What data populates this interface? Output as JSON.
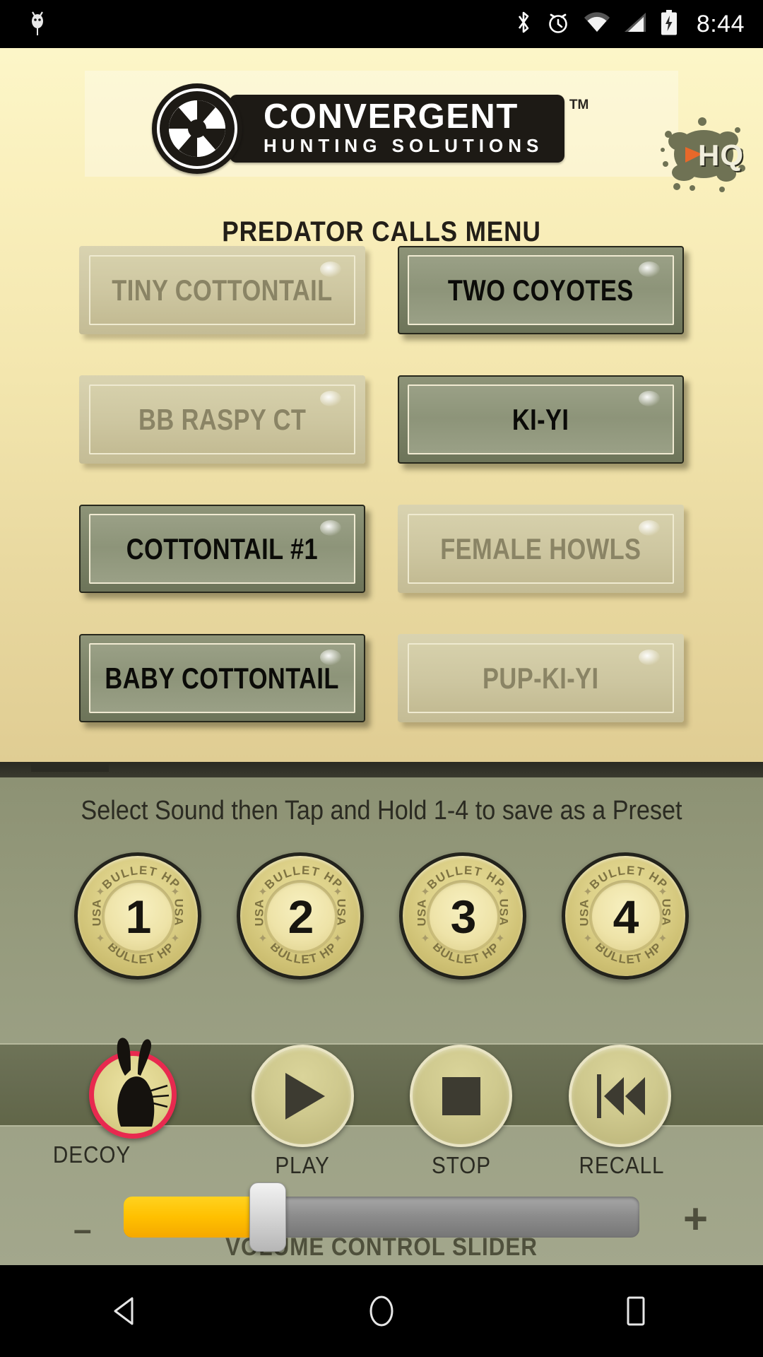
{
  "statusbar": {
    "time": "8:44",
    "icons": [
      "android-debug-icon",
      "bluetooth-icon",
      "alarm-icon",
      "wifi-icon",
      "cellular-signal-icon",
      "battery-charging-icon"
    ]
  },
  "header": {
    "logo_main": "CONVERGENT",
    "logo_sub": "HUNTING SOLUTIONS",
    "trademark": "TM",
    "menu_title": "PREDATOR CALLS MENU",
    "hq_label": "HQ"
  },
  "sounds": {
    "rows": [
      [
        {
          "label": "TINY COTTONTAIL",
          "active": false
        },
        {
          "label": "TWO COYOTES",
          "active": true
        }
      ],
      [
        {
          "label": "BB RASPY CT",
          "active": false
        },
        {
          "label": "KI-YI",
          "active": true
        }
      ],
      [
        {
          "label": "COTTONTAIL #1",
          "active": true
        },
        {
          "label": "FEMALE HOWLS",
          "active": false
        }
      ],
      [
        {
          "label": "BABY COTTONTAIL",
          "active": true
        },
        {
          "label": "PUP-KI-YI",
          "active": false
        }
      ]
    ]
  },
  "controls": {
    "hint": "Select Sound then Tap and Hold 1-4 to save as a Preset",
    "presets": [
      {
        "number": "1",
        "top_text": "BULLET HP",
        "bottom_text": "BULLET HP",
        "left_text": "USA",
        "right_text": "USA"
      },
      {
        "number": "2",
        "top_text": "BULLET HP",
        "bottom_text": "BULLET HP",
        "left_text": "USA",
        "right_text": "USA"
      },
      {
        "number": "3",
        "top_text": "BULLET HP",
        "bottom_text": "BULLET HP",
        "left_text": "USA",
        "right_text": "USA"
      },
      {
        "number": "4",
        "top_text": "BULLET HP",
        "bottom_text": "BULLET HP",
        "left_text": "USA",
        "right_text": "USA"
      }
    ],
    "transport": [
      {
        "label": "DECOY",
        "icon": "rabbit-decoy-icon"
      },
      {
        "label": "PLAY",
        "icon": "play-icon"
      },
      {
        "label": "STOP",
        "icon": "stop-icon"
      },
      {
        "label": "RECALL",
        "icon": "skip-to-start-icon"
      }
    ],
    "volume": {
      "caption": "VOLUME CONTROL SLIDER",
      "minus_label": "–",
      "plus_label": "+",
      "value_percent": 28
    }
  },
  "navbar": {
    "items": [
      {
        "name": "back-button",
        "icon": "back-triangle-icon"
      },
      {
        "name": "home-button",
        "icon": "home-circle-icon"
      },
      {
        "name": "recents-button",
        "icon": "recents-square-icon"
      }
    ]
  },
  "colors": {
    "panel_cream": "#f7eec0",
    "panel_olive": "#959a7c",
    "button_active": "#8d9479",
    "button_inactive": "#cdc6a0",
    "accent_yellow": "#ffc000",
    "decoy_red": "#e8294f",
    "hq_orange": "#e8682a"
  }
}
